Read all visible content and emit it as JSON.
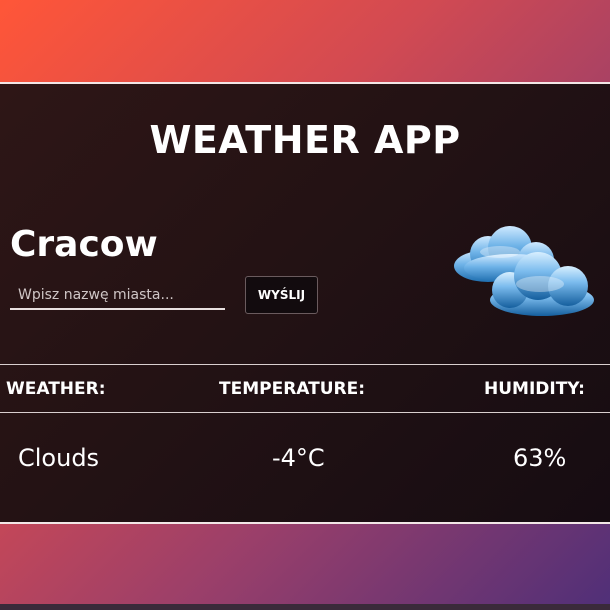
{
  "app": {
    "title": "WEATHER APP"
  },
  "location": {
    "city": "Cracow"
  },
  "search": {
    "placeholder": "Wpisz nazwę miasta...",
    "value": "",
    "button_label": "WYŚLIJ"
  },
  "weather_icon": {
    "name": "clouds-icon"
  },
  "table": {
    "headers": {
      "weather": "WEATHER:",
      "temperature": "TEMPERATURE:",
      "humidity": "HUMIDITY:"
    },
    "values": {
      "weather": "Clouds",
      "temperature": "-4°C",
      "humidity": "63%"
    }
  },
  "colors": {
    "gradient_start": "#ff5638",
    "gradient_end": "#4f2f78",
    "panel_bg": "#231214",
    "text": "#ffffff",
    "cloud_blue": "#2f86c8"
  }
}
